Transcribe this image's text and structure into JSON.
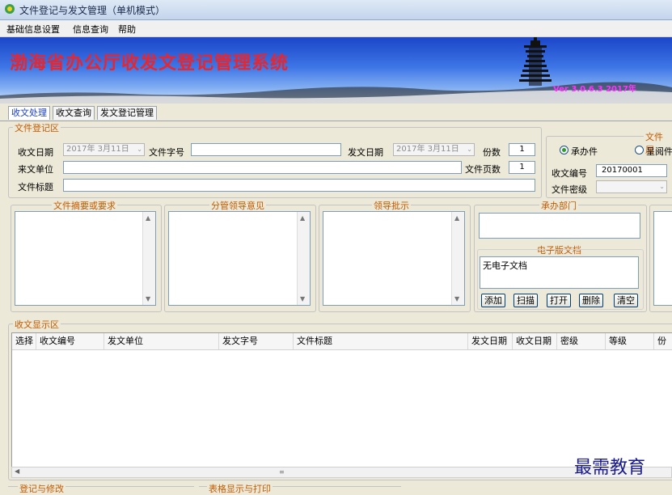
{
  "window": {
    "title": "文件登记与发文管理（单机模式）"
  },
  "menu": {
    "items": [
      "基础信息设置",
      "信息查询",
      "帮助"
    ]
  },
  "banner": {
    "title": "渤海省办公厅收发文登记管理系统",
    "version": "Ver 3.0.6.3  2017年"
  },
  "tabs": [
    {
      "label": "收文处理",
      "active": true
    },
    {
      "label": "收文查询",
      "active": false
    },
    {
      "label": "发文登记管理",
      "active": false
    }
  ],
  "registration": {
    "group_label": "文件登记区",
    "receive_date_label": "收文日期",
    "receive_date_value": "2017年 3月11日",
    "doc_number_label": "文件字号",
    "doc_number_value": "",
    "send_date_label": "发文日期",
    "send_date_value": "2017年 3月11日",
    "copies_label": "份数",
    "copies_value": "1",
    "from_unit_label": "来文单位",
    "from_unit_value": "",
    "pages_label": "文件页数",
    "pages_value": "1",
    "title_label": "文件标题",
    "title_value": ""
  },
  "file_type": {
    "group_label": "文件属",
    "radio_handle": "承办件",
    "radio_read": "呈阅件",
    "receive_no_label": "收文编号",
    "receive_no_value": "20170001",
    "secret_label": "文件密级",
    "secret_value": ""
  },
  "panels": {
    "summary_label": "文件摘要或要求",
    "leader_opinion_label": "分管领导意见",
    "leader_instruction_label": "领导批示",
    "dept_label": "承办部门",
    "edoc_label": "电子版文档",
    "edoc_value": "无电子文档",
    "buttons": {
      "add": "添加",
      "scan": "扫描",
      "open": "打开",
      "delete": "删除",
      "clear": "清空"
    }
  },
  "display": {
    "group_label": "收文显示区",
    "columns": [
      "选择",
      "收文编号",
      "发文单位",
      "发文字号",
      "文件标题",
      "发文日期",
      "收文日期",
      "密级",
      "等级",
      "份"
    ]
  },
  "bottom": {
    "left_label": "登记与修改",
    "right_label": "表格显示与打印"
  },
  "watermark": "最需教育"
}
